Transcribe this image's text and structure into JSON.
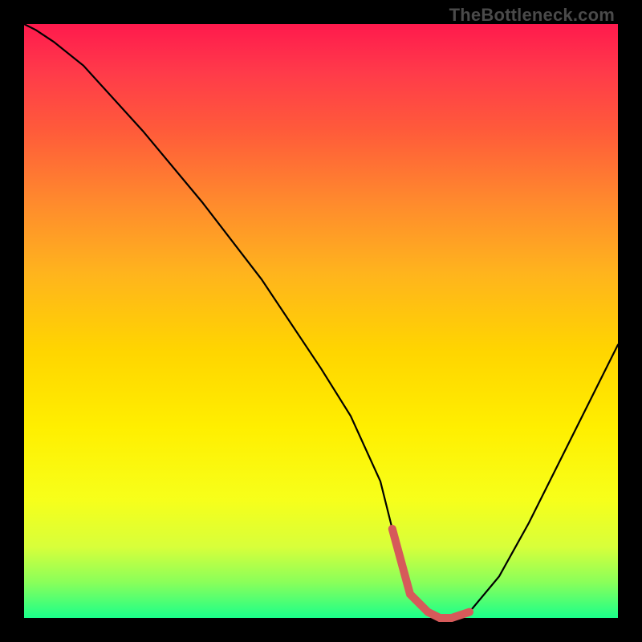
{
  "watermark": "TheBottleneck.com",
  "colors": {
    "frame_bg": "#000000",
    "watermark_text": "#4a4a4a",
    "curve": "#000000",
    "highlight": "#d65a5a",
    "gradient_top": "#ff1a4d",
    "gradient_bottom": "#1aff8a"
  },
  "chart_data": {
    "type": "line",
    "title": "",
    "xlabel": "",
    "ylabel": "",
    "x": [
      0,
      2,
      5,
      10,
      20,
      30,
      40,
      50,
      55,
      60,
      62,
      65,
      68,
      70,
      72,
      75,
      80,
      85,
      90,
      95,
      100
    ],
    "values": [
      100,
      99,
      97,
      93,
      82,
      70,
      57,
      42,
      34,
      23,
      15,
      4,
      1,
      0,
      0,
      1,
      7,
      16,
      26,
      36,
      46
    ],
    "xlim": [
      0,
      100
    ],
    "ylim": [
      0,
      100
    ],
    "highlight_range_x": [
      62,
      75
    ],
    "annotations": []
  }
}
